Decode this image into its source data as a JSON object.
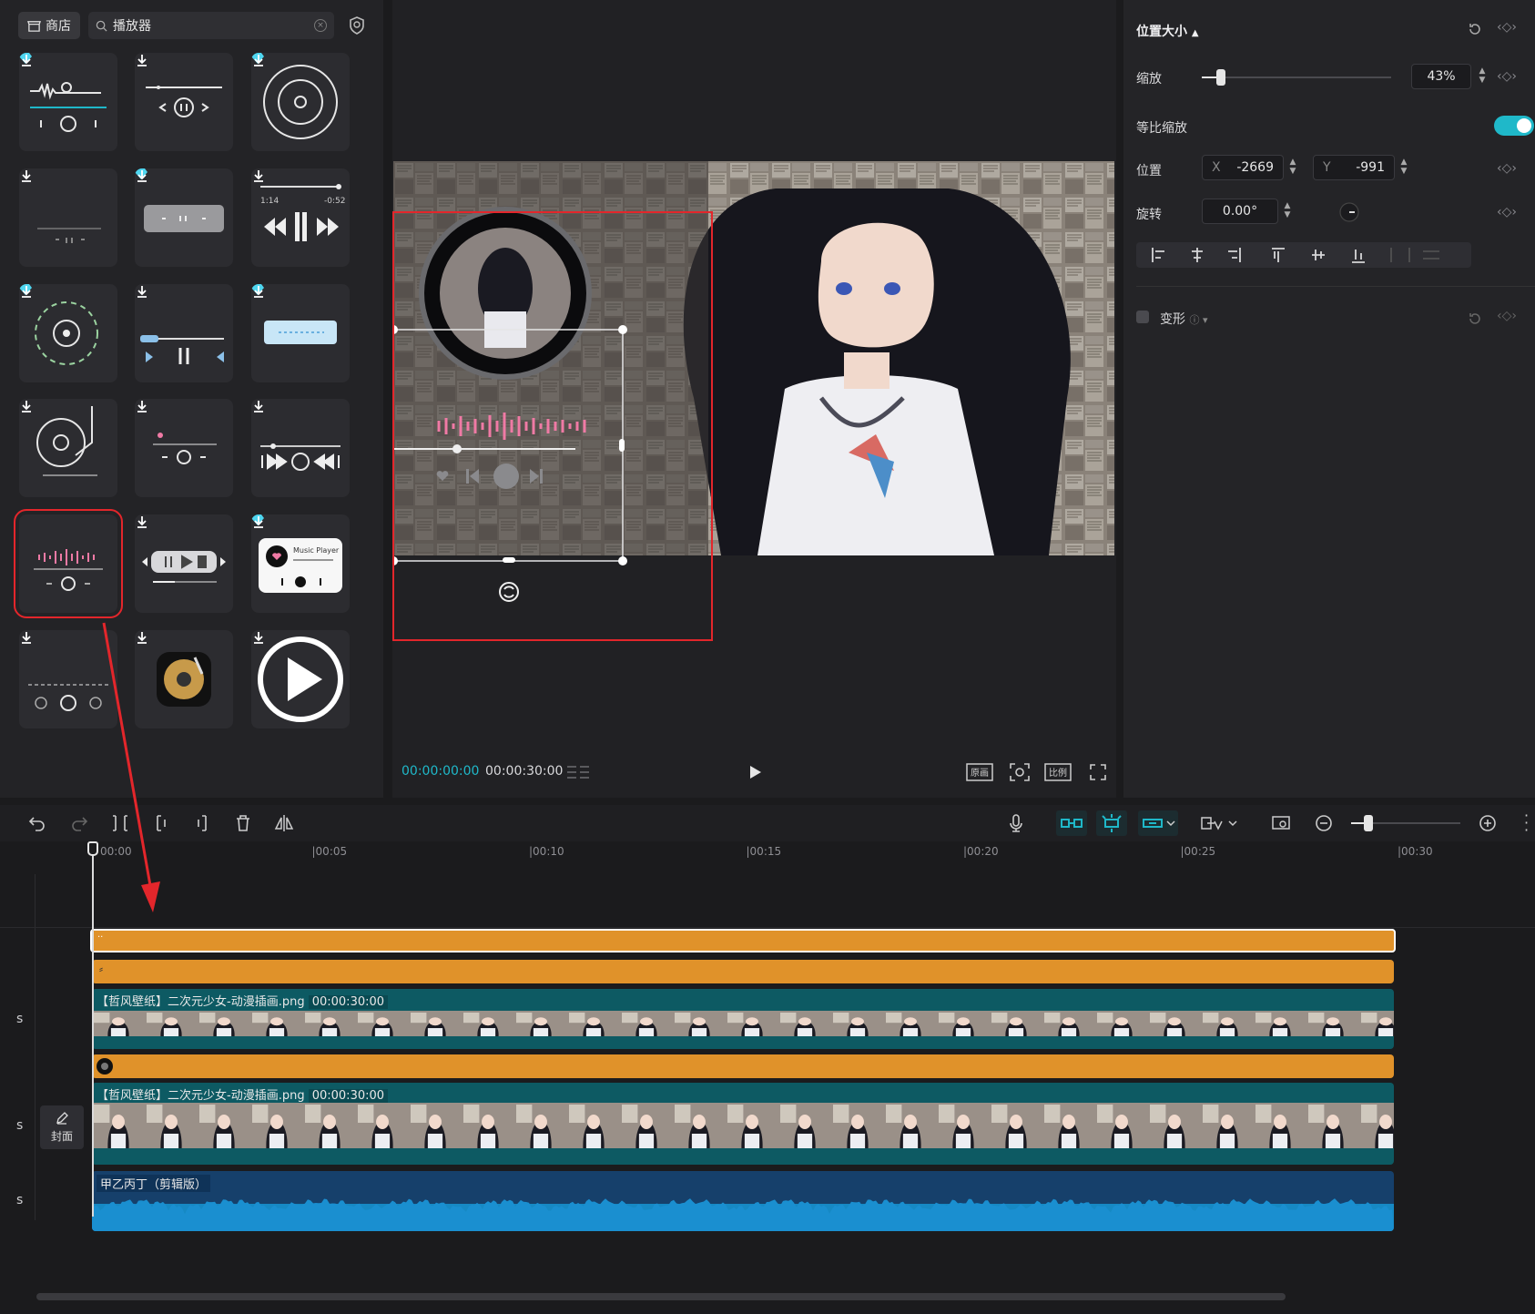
{
  "left_panel": {
    "store_label": "商店",
    "search_value": "播放器",
    "tiles": [
      {
        "name": "tile-player-1",
        "premium": true
      },
      {
        "name": "tile-player-2",
        "premium": false
      },
      {
        "name": "tile-player-3",
        "premium": true
      },
      {
        "name": "tile-player-4",
        "premium": false
      },
      {
        "name": "tile-player-5",
        "premium": true
      },
      {
        "name": "tile-player-6",
        "premium": false,
        "text_left": "1:14",
        "text_right": "-0:52"
      },
      {
        "name": "tile-player-7",
        "premium": true
      },
      {
        "name": "tile-player-8",
        "premium": false
      },
      {
        "name": "tile-player-9",
        "premium": true
      },
      {
        "name": "tile-player-10",
        "premium": false
      },
      {
        "name": "tile-player-11",
        "premium": false
      },
      {
        "name": "tile-player-12",
        "premium": false
      },
      {
        "name": "tile-player-13",
        "premium": false,
        "selected": true
      },
      {
        "name": "tile-player-14",
        "premium": false
      },
      {
        "name": "tile-player-15",
        "premium": true,
        "title": "Music Player"
      },
      {
        "name": "tile-player-16",
        "premium": false
      },
      {
        "name": "tile-player-17",
        "premium": false
      },
      {
        "name": "tile-player-18",
        "premium": false
      }
    ]
  },
  "preview": {
    "current_time": "00:00:00:00",
    "total_time": "00:00:30:00"
  },
  "properties": {
    "section_title": "位置大小",
    "scale_label": "缩放",
    "scale_value": "43%",
    "scale_fraction": 0.1,
    "uniform_scale_label": "等比缩放",
    "uniform_scale_on": true,
    "position_label": "位置",
    "x_label": "X",
    "x_value": "-2669",
    "y_label": "Y",
    "y_value": "-991",
    "rotation_label": "旋转",
    "rotation_value": "0.00°",
    "deform_label": "变形"
  },
  "timeline": {
    "ruler_ticks": [
      "00:00",
      "|00:05",
      "|00:10",
      "|00:15",
      "|00:20",
      "|00:25",
      "|00:30"
    ],
    "clip_image_1": {
      "name": "【哲风壁纸】二次元少女-动漫插画.png",
      "duration": "00:00:30:00"
    },
    "clip_image_2": {
      "name": "【哲风壁纸】二次元少女-动漫插画.png",
      "duration": "00:00:30:00"
    },
    "clip_audio": {
      "name": "甲乙丙丁（剪辑版）"
    },
    "track_s_labels": [
      "s",
      "s",
      "s"
    ],
    "cover_label": "封面"
  },
  "colors": {
    "accent": "#1fb8c9",
    "orange_track": "#e0922a",
    "video_track": "#0d5a63",
    "audio_track": "#16406b",
    "highlight": "#e3262b"
  }
}
